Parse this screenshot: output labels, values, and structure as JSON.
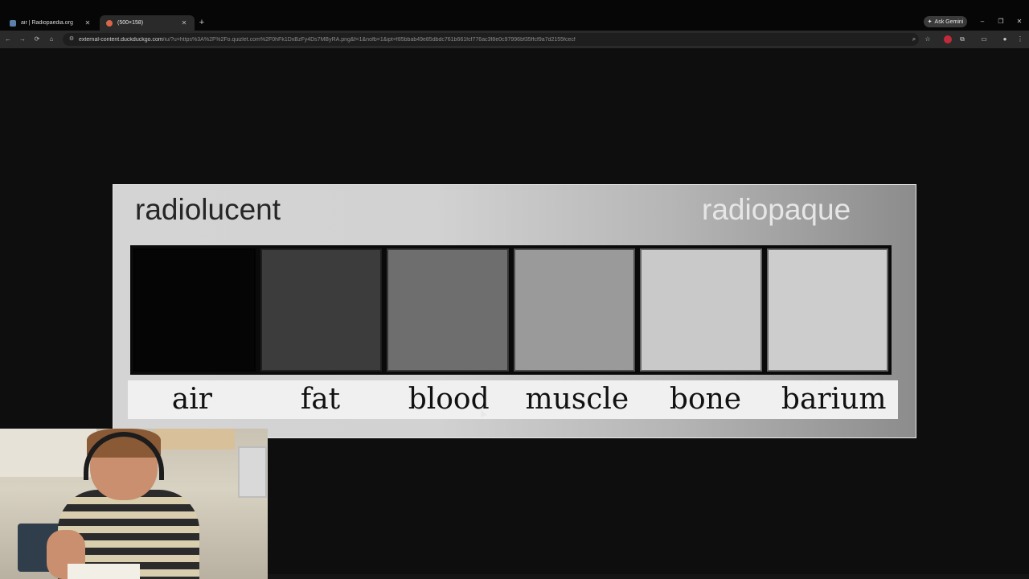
{
  "browser": {
    "tabs": [
      {
        "title": "air | Radiopaedia.org",
        "active": false
      },
      {
        "title": "(500×158)",
        "active": true
      }
    ],
    "new_tab": "+",
    "gemini_label": "Ask Gemini",
    "window_controls": {
      "minimize": "–",
      "restore": "❐",
      "close": "✕"
    },
    "url_host": "external-content.duckduckgo.com",
    "url_rest": "/iu/?u=https%3A%2F%2Fo.quizlet.com%2F0hFk1DxBzFy4Ds7MByRA.png&f=1&nofb=1&ipt=f85bbab49e85dbdc761b661fcf776ac3f8e0c97996bf35ffcf9a7d2155fcecf"
  },
  "image": {
    "label_left": "radiolucent",
    "label_right": "radiopaque",
    "swatches": [
      {
        "name": "air",
        "color": "#050505"
      },
      {
        "name": "fat",
        "color": "#3c3c3c"
      },
      {
        "name": "blood",
        "color": "#6e6e6e"
      },
      {
        "name": "muscle",
        "color": "#9a9a9a"
      },
      {
        "name": "bone",
        "color": "#c9c9c9"
      },
      {
        "name": "barium",
        "color": "#cdcdcd"
      }
    ]
  }
}
